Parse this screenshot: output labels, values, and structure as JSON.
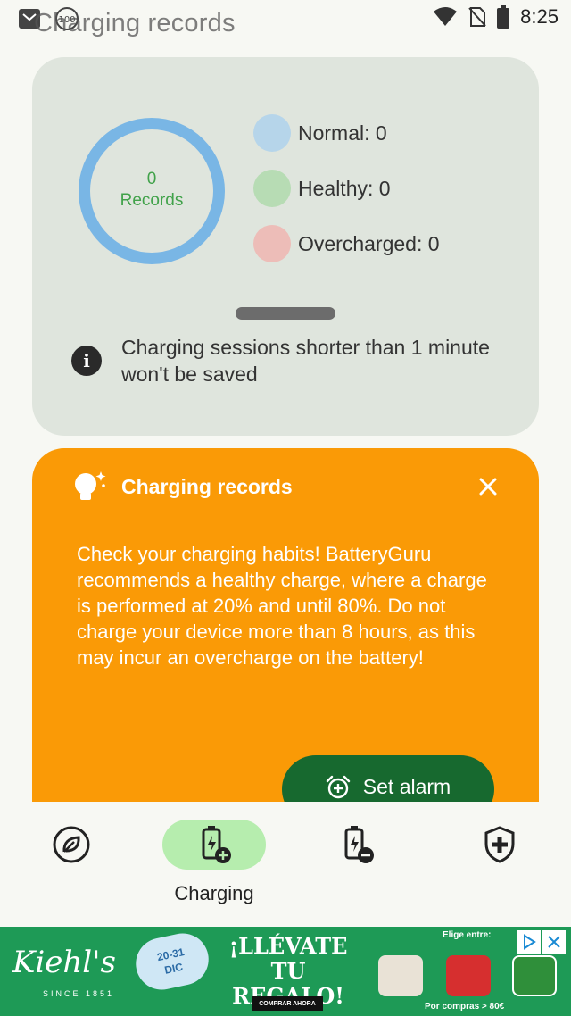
{
  "status_bar": {
    "title": "Charging records",
    "badge": "100",
    "time": "8:25"
  },
  "records": {
    "count": "0",
    "count_label": "Records",
    "legend": [
      {
        "label": "Normal: 0",
        "color": "#b6d5ea"
      },
      {
        "label": "Healthy: 0",
        "color": "#b7dcb4"
      },
      {
        "label": "Overcharged: 0",
        "color": "#edbdb8"
      }
    ],
    "info": "Charging sessions shorter than 1 minute won't be saved"
  },
  "tip": {
    "title": "Charging records",
    "body": "Check your charging habits! BatteryGuru recommends a healthy charge, where a charge is performed at 20% and until 80%. Do not charge your device more than 8 hours, as this may incur an overcharge on the battery!",
    "button": "Set alarm"
  },
  "nav": {
    "active_label": "Charging"
  },
  "ad": {
    "brand": "Kiehl's",
    "since": "SINCE 1851",
    "date_line1": "20-31",
    "date_line2": "DIC",
    "headline": "¡LLÉVATE TU REGALO!",
    "cta": "COMPRAR AHORA",
    "choose": "Elige entre:",
    "foot": "Por compras > 80€"
  },
  "colors": {
    "ring": "#79b6e5",
    "card": "#dfe5dd",
    "tip": "#fa9a06",
    "button": "#17692f",
    "nav_active": "#b6edae",
    "ad": "#1e9a56"
  }
}
